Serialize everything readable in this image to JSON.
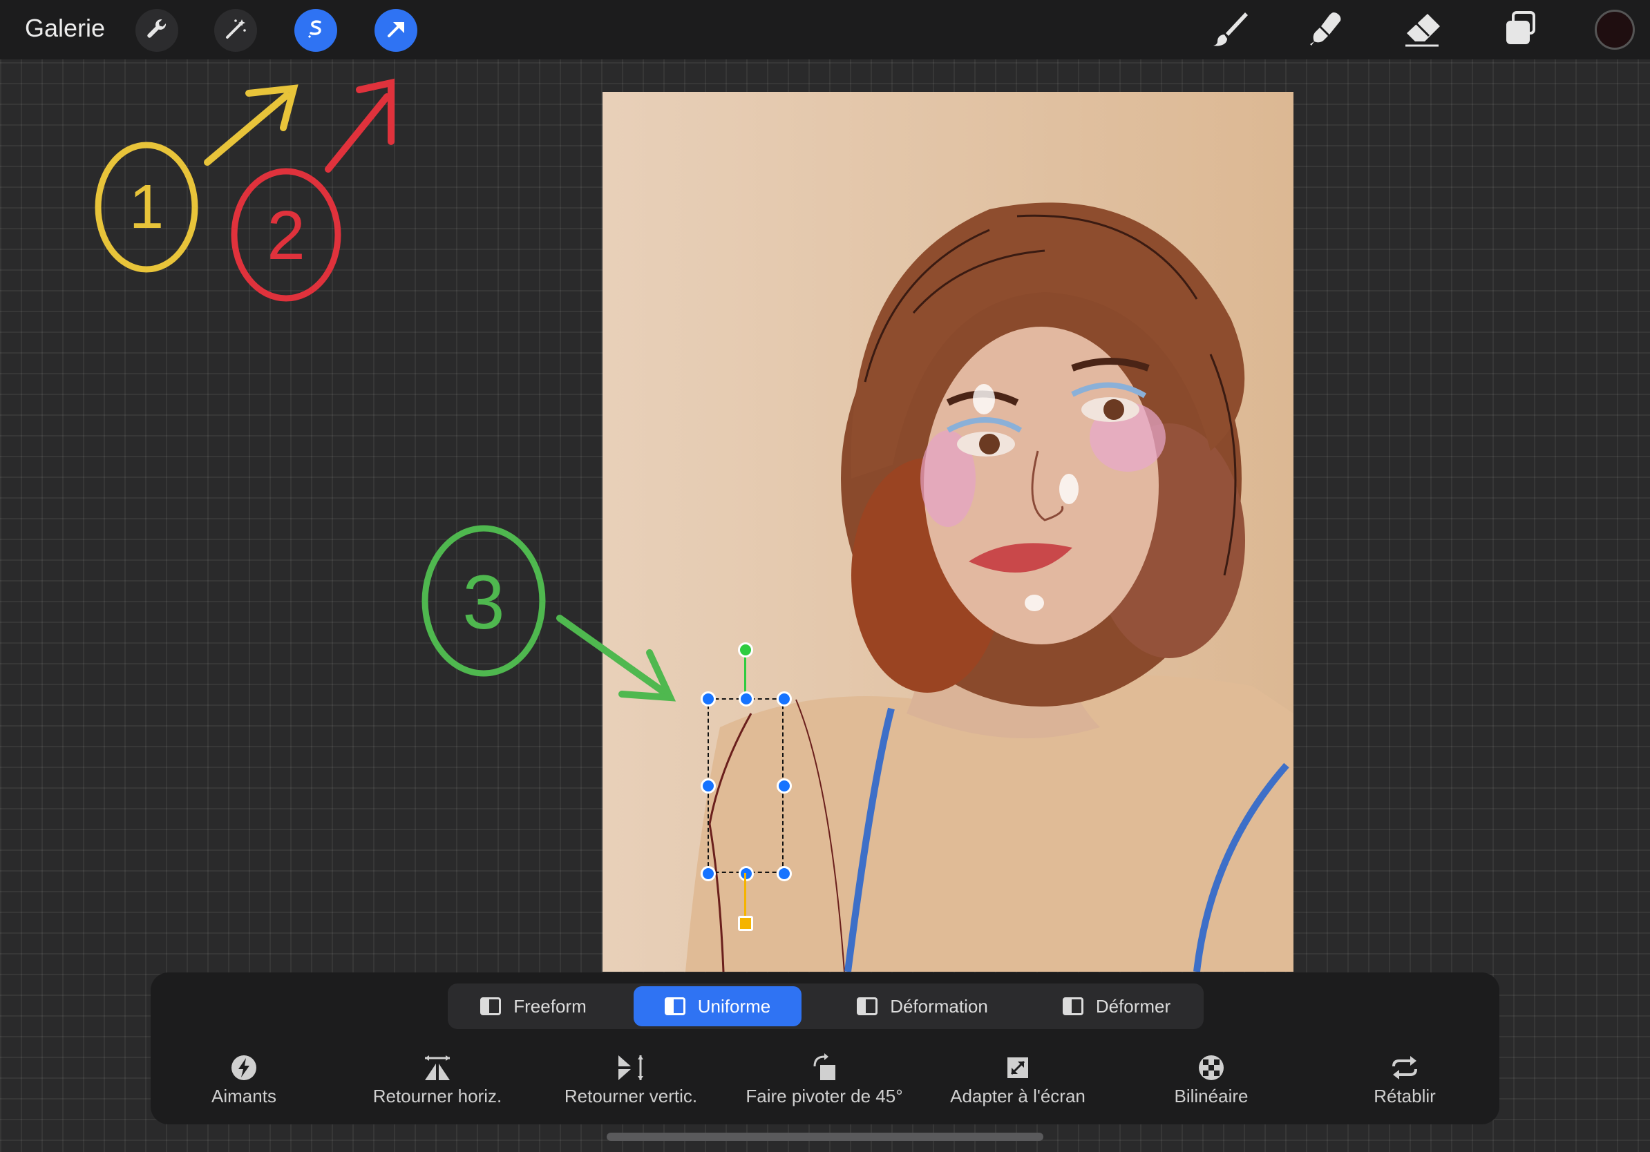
{
  "topbar": {
    "gallery_label": "Galerie",
    "left_tools": [
      {
        "icon": "wrench-icon"
      },
      {
        "icon": "magic-wand-icon"
      },
      {
        "icon": "selection-icon",
        "active": true
      },
      {
        "icon": "transform-arrow-icon",
        "active": true
      }
    ],
    "right_tools": [
      {
        "icon": "brush-icon"
      },
      {
        "icon": "smudge-icon"
      },
      {
        "icon": "eraser-icon"
      },
      {
        "icon": "layers-icon"
      }
    ],
    "current_color": "#1f0e10"
  },
  "annotations": {
    "labels": [
      "1",
      "2",
      "3"
    ],
    "colors": [
      "#e8c43a",
      "#e0323c",
      "#4fb84f"
    ]
  },
  "transform": {
    "modes": [
      {
        "label": "Freeform",
        "active": false
      },
      {
        "label": "Uniforme",
        "active": true
      },
      {
        "label": "Déformation",
        "active": false
      },
      {
        "label": "Déformer",
        "active": false
      }
    ],
    "actions": [
      {
        "label": "Aimants",
        "icon": "magnet-bolt-icon"
      },
      {
        "label": "Retourner horiz.",
        "icon": "flip-horizontal-icon"
      },
      {
        "label": "Retourner vertic.",
        "icon": "flip-vertical-icon"
      },
      {
        "label": "Faire pivoter de 45°",
        "icon": "rotate-45-icon"
      },
      {
        "label": "Adapter à l'écran",
        "icon": "fit-screen-icon"
      },
      {
        "label": "Bilinéaire",
        "icon": "bilinear-icon"
      },
      {
        "label": "Rétablir",
        "icon": "reset-icon"
      }
    ]
  },
  "colors": {
    "accent": "#2f73f3",
    "rotate_handle": "#2ecc40",
    "scale_handle": "#f5b400",
    "canvas_bg": "#e2c4a3"
  }
}
